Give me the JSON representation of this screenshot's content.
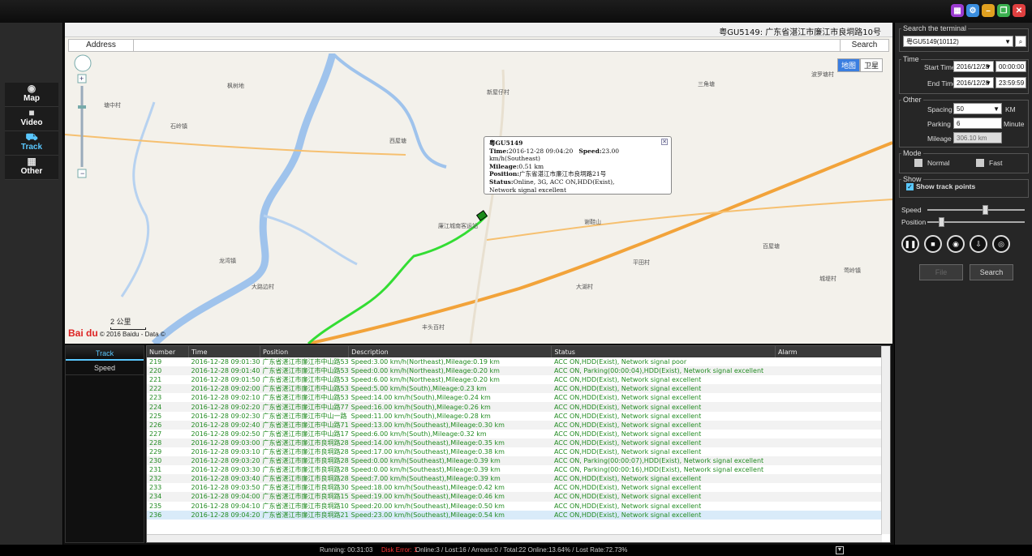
{
  "nav": {
    "items": [
      {
        "label": "Map",
        "icon": "map-pin-icon"
      },
      {
        "label": "Video",
        "icon": "video-camera-icon"
      },
      {
        "label": "Track",
        "icon": "car-icon"
      },
      {
        "label": "Other",
        "icon": "grid-icon"
      }
    ]
  },
  "map": {
    "terminal_title": "粤GU5149: 广东省湛江市廉江市良垌路10号",
    "address_label": "Address",
    "search_label": "Search",
    "type_map": "地图",
    "type_satellite": "卫星",
    "scale": "2 公里",
    "copyright": "© 2016 Baidu - Data ©",
    "baidu_logo": "Bai du",
    "popup": {
      "title": "粤GU5149",
      "time_label": "Time:",
      "time_value": "2016-12-28 09:04:20",
      "speed_label": "Speed:",
      "speed_value": "23.00 km/h(Southeast)",
      "mileage_label": "Mileage:",
      "mileage_value": "0.51 km",
      "position_label": "Position:",
      "position_value": "广东省湛江市廉江市良垌路21号",
      "status_label": "Status:",
      "status_value": "Online, 3G, ACC ON,HDD(Exist),",
      "status_value2": "Network signal excellent"
    }
  },
  "right": {
    "search_terminal_legend": "Search the terminal",
    "terminal_value": "粤GU5149(10112)",
    "time_legend": "Time",
    "start_label": "Start Time",
    "start_date": "2016/12/28",
    "start_time": "00:00:00",
    "end_label": "End Time",
    "end_date": "2016/12/28",
    "end_time": "23:59:59",
    "other_legend": "Other",
    "spacing_label": "Spacing",
    "spacing_value": "50",
    "spacing_unit": "KM",
    "parking_label": "Parking",
    "parking_value": "6",
    "parking_unit": "Minute",
    "mileage_label": "Mileage",
    "mileage_value": "306.10 km",
    "mode_legend": "Mode",
    "mode_normal": "Normal",
    "mode_fast": "Fast",
    "show_legend": "Show",
    "show_track_points": "Show track points",
    "speed_label": "Speed",
    "speed_level": 0.6,
    "position_label": "Position",
    "position_level": 0.12,
    "file_button": "File",
    "search_button": "Search"
  },
  "bottom": {
    "tabs": [
      "Track",
      "Speed"
    ],
    "columns": [
      "Number",
      "Time",
      "Position",
      "Description",
      "Status",
      "Alarm"
    ],
    "rows": [
      [
        "219",
        "2016-12-28 09:01:30",
        "广东省湛江市廉江市中山路53",
        "Speed:3.00 km/h(Northeast),Mileage:0.19 km",
        "ACC ON,HDD(Exist), Network signal poor",
        ""
      ],
      [
        "220",
        "2016-12-28 09:01:40",
        "广东省湛江市廉江市中山路53",
        "Speed:0.00 km/h(Northeast),Mileage:0.20 km",
        "ACC ON, Parking(00:00:04),HDD(Exist), Network signal excellent",
        ""
      ],
      [
        "221",
        "2016-12-28 09:01:50",
        "广东省湛江市廉江市中山路53",
        "Speed:6.00 km/h(Northeast),Mileage:0.20 km",
        "ACC ON,HDD(Exist), Network signal excellent",
        ""
      ],
      [
        "222",
        "2016-12-28 09:02:00",
        "广东省湛江市廉江市中山路53",
        "Speed:5.00 km/h(South),Mileage:0.23 km",
        "ACC ON,HDD(Exist), Network signal excellent",
        ""
      ],
      [
        "223",
        "2016-12-28 09:02:10",
        "广东省湛江市廉江市中山路53",
        "Speed:14.00 km/h(South),Mileage:0.24 km",
        "ACC ON,HDD(Exist), Network signal excellent",
        ""
      ],
      [
        "224",
        "2016-12-28 09:02:20",
        "广东省湛江市廉江市中山路77",
        "Speed:16.00 km/h(South),Mileage:0.26 km",
        "ACC ON,HDD(Exist), Network signal excellent",
        ""
      ],
      [
        "225",
        "2016-12-28 09:02:30",
        "广东省湛江市廉江市中山一路",
        "Speed:11.00 km/h(South),Mileage:0.28 km",
        "ACC ON,HDD(Exist), Network signal excellent",
        ""
      ],
      [
        "226",
        "2016-12-28 09:02:40",
        "广东省湛江市廉江市中山路71",
        "Speed:13.00 km/h(Southeast),Mileage:0.30 km",
        "ACC ON,HDD(Exist), Network signal excellent",
        ""
      ],
      [
        "227",
        "2016-12-28 09:02:50",
        "广东省湛江市廉江市中山路17",
        "Speed:6.00 km/h(South),Mileage:0.32 km",
        "ACC ON,HDD(Exist), Network signal excellent",
        ""
      ],
      [
        "228",
        "2016-12-28 09:03:00",
        "广东省湛江市廉江市良垌路28",
        "Speed:14.00 km/h(Southeast),Mileage:0.35 km",
        "ACC ON,HDD(Exist), Network signal excellent",
        ""
      ],
      [
        "229",
        "2016-12-28 09:03:10",
        "广东省湛江市廉江市良垌路28",
        "Speed:17.00 km/h(Southeast),Mileage:0.38 km",
        "ACC ON,HDD(Exist), Network signal excellent",
        ""
      ],
      [
        "230",
        "2016-12-28 09:03:20",
        "广东省湛江市廉江市良垌路28",
        "Speed:0.00 km/h(Southeast),Mileage:0.39 km",
        "ACC ON, Parking(00:00:07),HDD(Exist), Network signal excellent",
        ""
      ],
      [
        "231",
        "2016-12-28 09:03:30",
        "广东省湛江市廉江市良垌路28",
        "Speed:0.00 km/h(Southeast),Mileage:0.39 km",
        "ACC ON, Parking(00:00:16),HDD(Exist), Network signal excellent",
        ""
      ],
      [
        "232",
        "2016-12-28 09:03:40",
        "广东省湛江市廉江市良垌路28",
        "Speed:7.00 km/h(Southeast),Mileage:0.39 km",
        "ACC ON,HDD(Exist), Network signal excellent",
        ""
      ],
      [
        "233",
        "2016-12-28 09:03:50",
        "广东省湛江市廉江市良垌路30",
        "Speed:18.00 km/h(Southeast),Mileage:0.42 km",
        "ACC ON,HDD(Exist), Network signal excellent",
        ""
      ],
      [
        "234",
        "2016-12-28 09:04:00",
        "广东省湛江市廉江市良垌路15",
        "Speed:19.00 km/h(Southeast),Mileage:0.46 km",
        "ACC ON,HDD(Exist), Network signal excellent",
        ""
      ],
      [
        "235",
        "2016-12-28 09:04:10",
        "广东省湛江市廉江市良垌路10",
        "Speed:20.00 km/h(Southeast),Mileage:0.50 km",
        "ACC ON,HDD(Exist), Network signal excellent",
        ""
      ],
      [
        "236",
        "2016-12-28 09:04:20",
        "广东省湛江市廉江市良垌路21",
        "Speed:23.00 km/h(Southeast),Mileage:0.54 km",
        "ACC ON,HDD(Exist), Network signal excellent",
        ""
      ]
    ]
  },
  "status": {
    "running": "Running: 00:31:03",
    "disk_error": "Disk Error: 1",
    "stats": "Online:3 / Lost:16 / Arrears:0 / Total:22   Online:13.64% / Lost Rate:72.73%"
  },
  "colors": {
    "accent": "#5ac8ff",
    "track_line": "#33dd33",
    "road": "#f2a33a",
    "river": "#8fb7e8",
    "disk_error": "#ff3333"
  }
}
